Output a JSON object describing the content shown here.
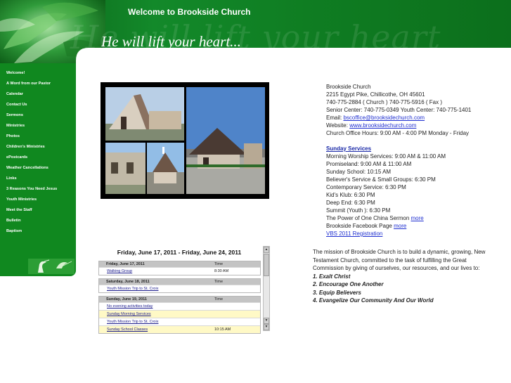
{
  "header": {
    "title": "Welcome to Brookside Church",
    "tagline": "He will lift your heart...",
    "tagline_ghost": "He will lift your heart"
  },
  "colors": {
    "brand_green": "#10881f",
    "dark_green": "#0a5d16",
    "link_blue": "#1f2fd0",
    "highlight_yellow": "#fff9c6"
  },
  "nav": [
    "Welcome!",
    "A Word from our Pastor",
    "Calendar",
    "Contact Us",
    "Sermons",
    "Ministries",
    "Photos",
    "Children's Ministries",
    "ePostcards",
    "Weather Cancellations",
    "Links",
    "3 Reasons You Need Jesus",
    "Youth Ministries",
    "Meet the Staff",
    "Bulletin",
    "Baptism"
  ],
  "contact": {
    "name": "Brookside Church",
    "address": "2215 Egypt Pike, Chillicothe, OH 45601",
    "phone": "740-775-2884 ( Church )  740-775-5916 ( Fax )",
    "centers": "Senior Center: 740-775-0349  Youth Center: 740-775-1401",
    "email_label": "Email:",
    "email": "bscoffice@brooksidechurch.com",
    "website_label": "Website:",
    "website": "www.brooksidechurch.com",
    "hours": "Church Office Hours: 9:00 AM - 4:00 PM Monday - Friday"
  },
  "services": {
    "title": "Sunday Services",
    "lines": [
      "Morning Worship Services: 9:00 AM & 11:00 AM",
      "Promiseland: 9:00 AM & 11:00 AM",
      "Sunday School: 10:15 AM",
      "Believer's Service & Small Groups: 6:30 PM",
      "Contemporary Service: 6:30 PM",
      "Kid's Klub: 6:30 PM",
      "Deep End: 6:30 PM",
      "Summit (Youth ): 6:30 PM"
    ],
    "sermon_text": "The Power of One China Sermon",
    "sermon_link": "more",
    "facebook_text": "Brookside Facebook Page",
    "facebook_link": "more",
    "vbs_link": "VBS 2011 Registration"
  },
  "calendar": {
    "range": "Friday, June 17, 2011 - Friday, June 24, 2011",
    "time_header": "Time",
    "days": [
      {
        "date": "Friday, June 17, 2011",
        "events": [
          {
            "name": "Walking Group",
            "time": "8:30 AM",
            "highlight": false
          }
        ]
      },
      {
        "date": "Saturday, June 18, 2011",
        "events": [
          {
            "name": "Youth Mission Trip to St. Croix",
            "time": "",
            "highlight": false
          }
        ]
      },
      {
        "date": "Sunday, June 19, 2011",
        "events": [
          {
            "name": "No evening activities today",
            "time": "",
            "highlight": false
          },
          {
            "name": "Sunday Morning Services",
            "time": "",
            "highlight": true
          },
          {
            "name": "Youth Mission Trip to St. Croix",
            "time": "",
            "highlight": false
          },
          {
            "name": "Sunday School Classes",
            "time": "10:15 AM",
            "highlight": true
          }
        ]
      }
    ]
  },
  "mission": {
    "text": "The mission of Brookside Church is to build a dynamic, growing, New Testament  Church, committed to the task of fulfilling the Great Commission by giving of ourselves, our resources, and our lives to:",
    "goals": [
      "1. Exalt Christ",
      "2. Encourage One Another",
      "3. Equip Believers",
      "4. Evangelize Our Community And Our World"
    ]
  }
}
